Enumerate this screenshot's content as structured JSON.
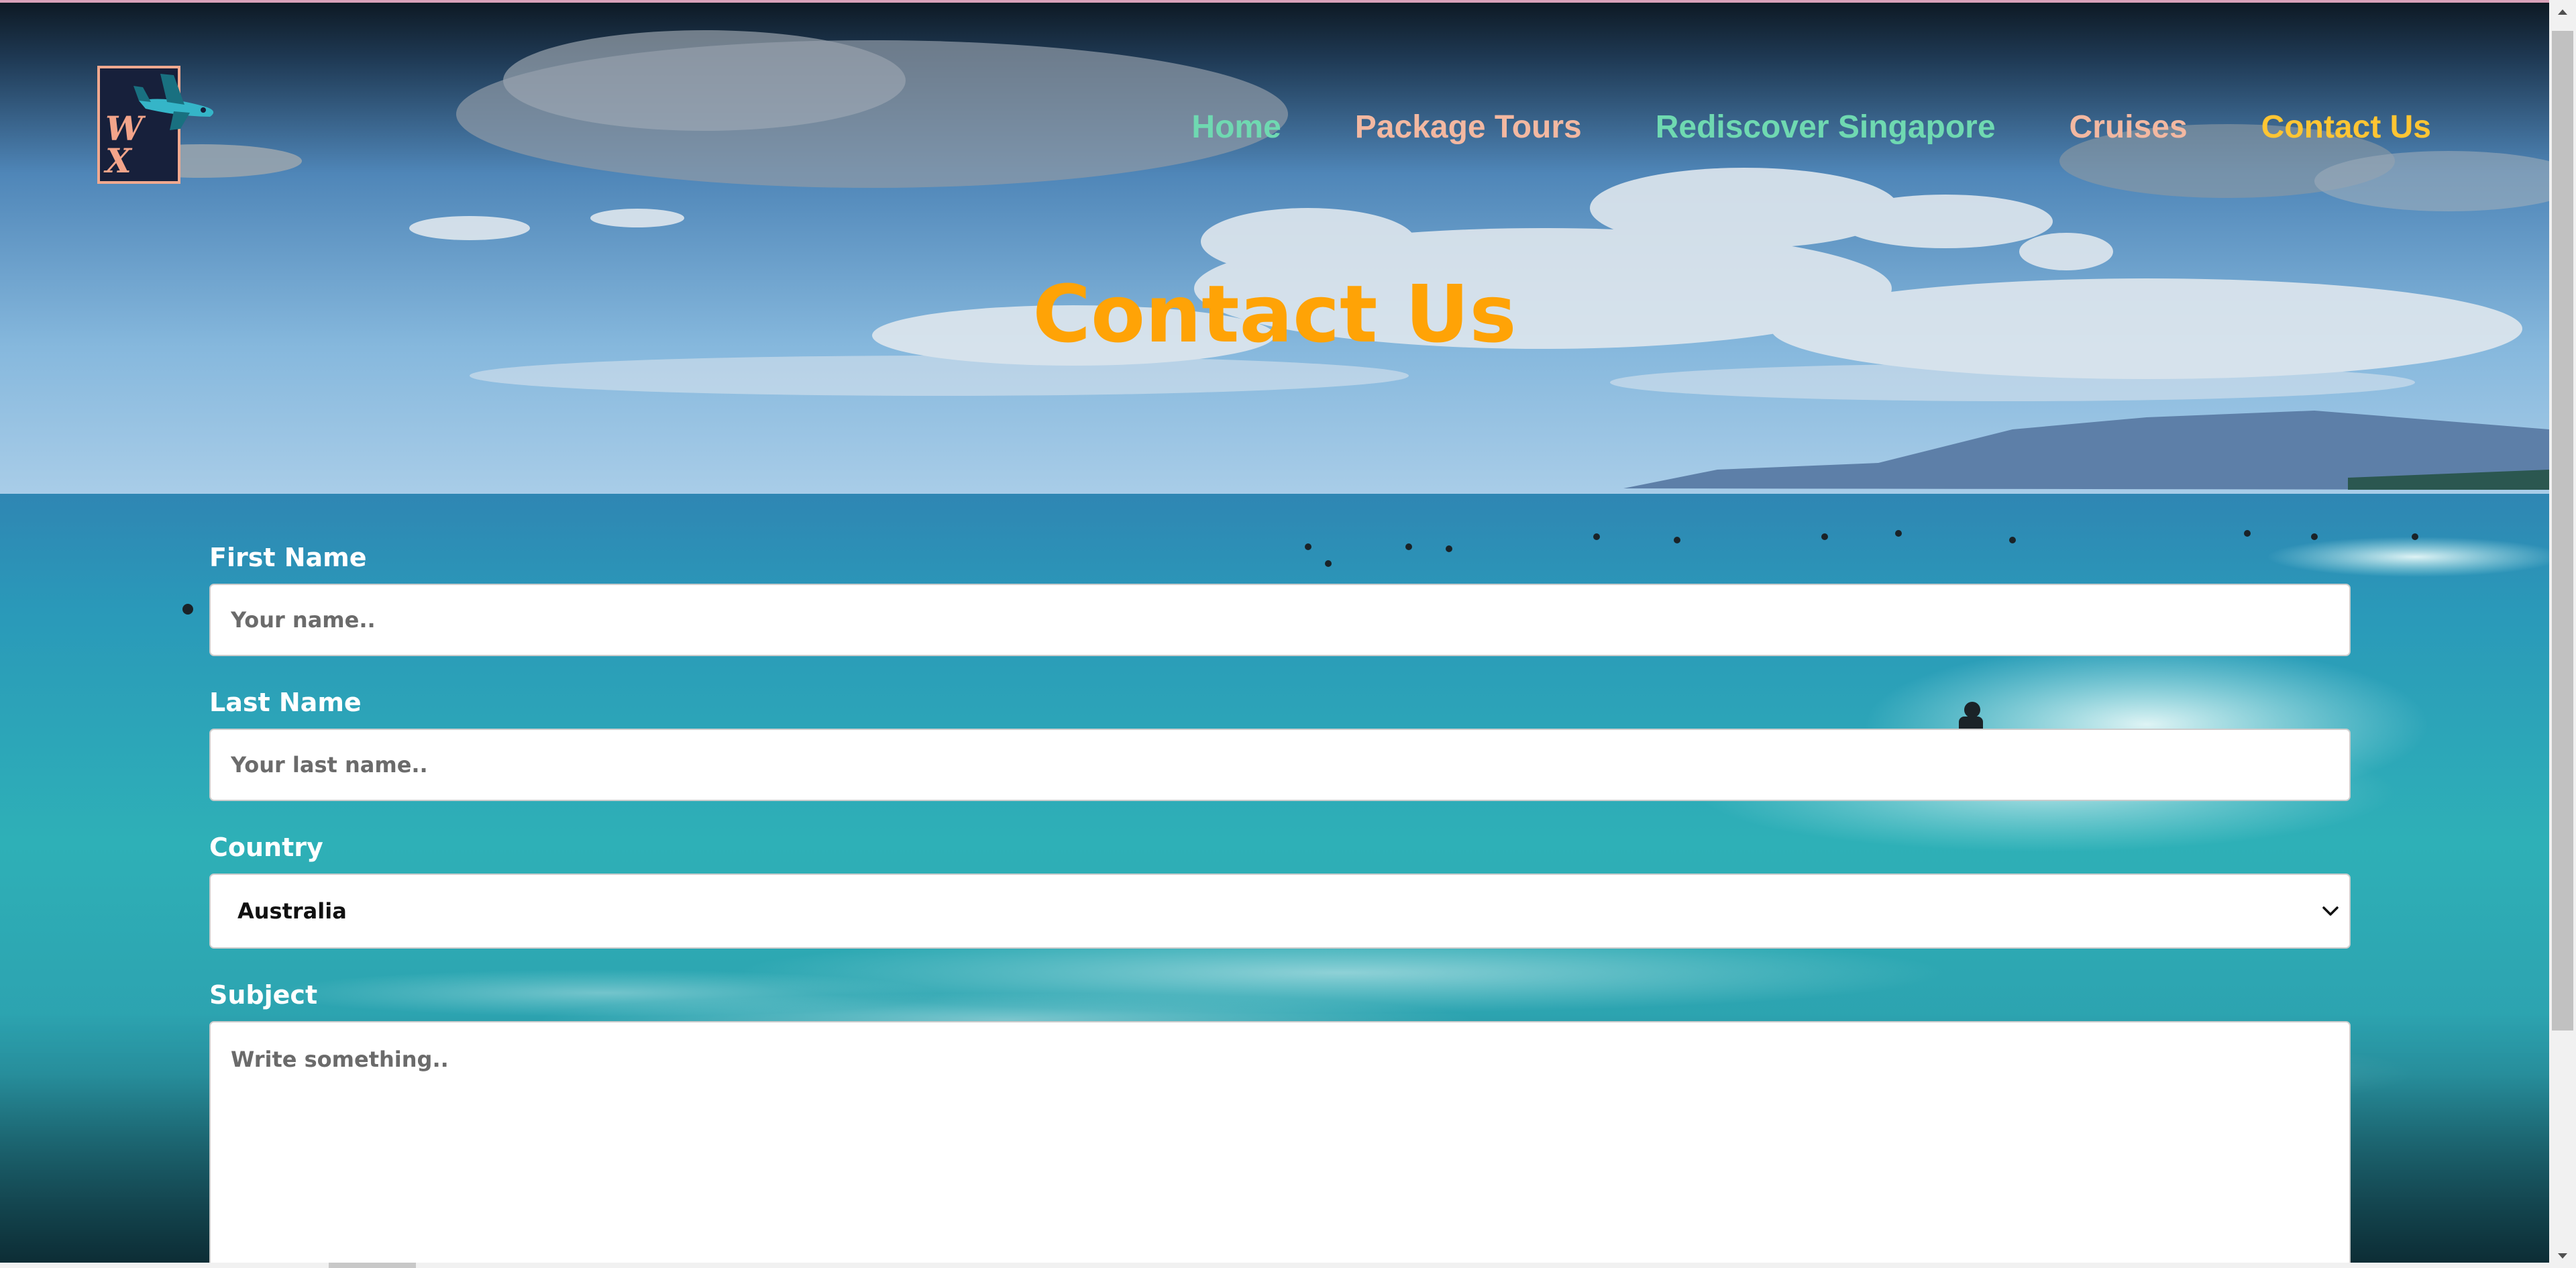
{
  "brand": {
    "logo_letters": "W\nX",
    "logo_icon": "airplane-icon",
    "colors": {
      "logo_bg": "#17203b",
      "logo_border": "#f2a98f"
    }
  },
  "nav": {
    "items": [
      {
        "label": "Home",
        "color": "#6fd9b1"
      },
      {
        "label": "Package Tours",
        "color": "#f3b8a1"
      },
      {
        "label": "Rediscover Singapore",
        "color": "#6fd9b1"
      },
      {
        "label": "Cruises",
        "color": "#f3b8a1"
      },
      {
        "label": "Contact Us",
        "color": "#ffc533",
        "active": true
      }
    ]
  },
  "page": {
    "title": "Contact Us",
    "title_color": "#ffa306"
  },
  "form": {
    "first_name": {
      "label": "First Name",
      "placeholder": "Your name..",
      "value": ""
    },
    "last_name": {
      "label": "Last Name",
      "placeholder": "Your last name..",
      "value": ""
    },
    "country": {
      "label": "Country",
      "selected": "Australia",
      "icon": "chevron-down-icon"
    },
    "subject": {
      "label": "Subject",
      "placeholder": "Write something..",
      "value": ""
    }
  }
}
